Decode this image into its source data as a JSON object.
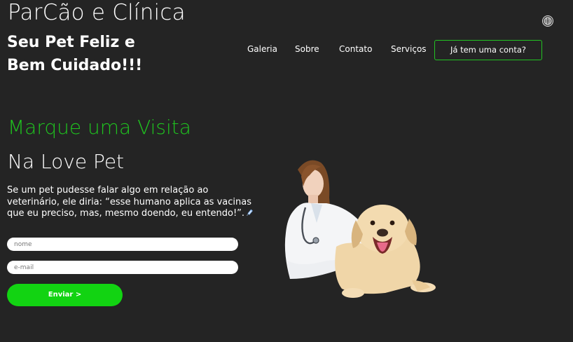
{
  "header": {
    "brand": "ParCão e Clínica",
    "tagline": "Seu Pet Feliz e Bem Cuidado!!!",
    "language_icon": "globe-icon"
  },
  "nav": {
    "items": [
      {
        "label": "Galeria"
      },
      {
        "label": "Sobre"
      },
      {
        "label": "Contato"
      },
      {
        "label": "Serviços"
      }
    ],
    "account_label": "Já tem uma conta?"
  },
  "hero": {
    "title_green": "Marque uma Visita",
    "title_white": "Na Love Pet",
    "description": "Se um pet pudesse falar algo em relação ao veterinário, ele diria: “esse humano aplica as vacinas que eu preciso, mas, mesmo doendo, eu entendo!”.",
    "description_icon": "syringe-icon"
  },
  "form": {
    "name_placeholder": "nome",
    "name_value": "",
    "email_placeholder": "e-mail",
    "email_value": "",
    "submit_label": "Enviar >"
  },
  "colors": {
    "background": "#242424",
    "accent_green": "#1fc31f",
    "button_green": "#12d312",
    "text": "#ffffff"
  }
}
